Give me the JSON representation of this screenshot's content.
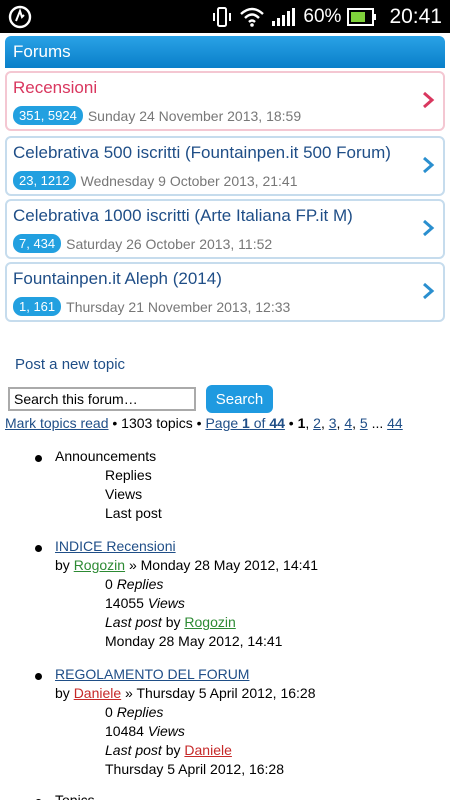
{
  "status_bar": {
    "battery_percent": "60%",
    "time": "20:41"
  },
  "header": {
    "title": "Forums"
  },
  "forums": [
    {
      "title": "Recensioni",
      "counts": "351, 5924",
      "date": "Sunday 24 November 2013, 18:59",
      "highlighted": true
    },
    {
      "title": "Celebrativa 500 iscritti (Fountainpen.it 500 Forum)",
      "counts": "23, 1212",
      "date": "Wednesday 9 October 2013, 21:41",
      "highlighted": false
    },
    {
      "title": "Celebrativa 1000 iscritti (Arte Italiana FP.it M)",
      "counts": "7, 434",
      "date": "Saturday 26 October 2013, 11:52",
      "highlighted": false
    },
    {
      "title": "Fountainpen.it Aleph (2014)",
      "counts": "1, 161",
      "date": "Thursday 21 November 2013, 12:33",
      "highlighted": false
    }
  ],
  "actions": {
    "post_new_topic": "Post a new topic"
  },
  "search": {
    "value": "Search this forum…",
    "button": "Search"
  },
  "pagination": {
    "mark_read": "Mark topics read",
    "topics_count": " • 1303 topics • ",
    "page_prefix": "Page ",
    "current": "1",
    "of": " of ",
    "total": "44",
    "sep": " • ",
    "pages": [
      "1",
      "2",
      "3",
      "4",
      "5"
    ],
    "ellipsis": " ... ",
    "last": "44"
  },
  "topic_header": {
    "announcements": "Announcements",
    "replies": "Replies",
    "views": "Views",
    "last_post": "Last post"
  },
  "topics": [
    {
      "title": "INDICE Recensioni",
      "by": "by ",
      "author": "Rogozin",
      "posted": " » Monday 28 May 2012, 14:41",
      "replies_num": "0 ",
      "replies_label": "Replies",
      "views_num": "14055 ",
      "views_label": "Views",
      "last_post_label": "Last post",
      "last_by": " by ",
      "last_author": "Rogozin",
      "last_date": "Monday 28 May 2012, 14:41"
    },
    {
      "title": "REGOLAMENTO DEL FORUM",
      "by": "by ",
      "author": "Daniele",
      "posted": " » Thursday 5 April 2012, 16:28",
      "replies_num": "0 ",
      "replies_label": "Replies",
      "views_num": "10484 ",
      "views_label": "Views",
      "last_post_label": "Last post",
      "last_by": " by ",
      "last_author": "Daniele",
      "last_date": "Thursday 5 April 2012, 16:28"
    }
  ],
  "partial_next": "Topics",
  "colors": {
    "accent": "#1f9ae0",
    "highlight": "#d9375f",
    "link": "#1f4e87"
  }
}
